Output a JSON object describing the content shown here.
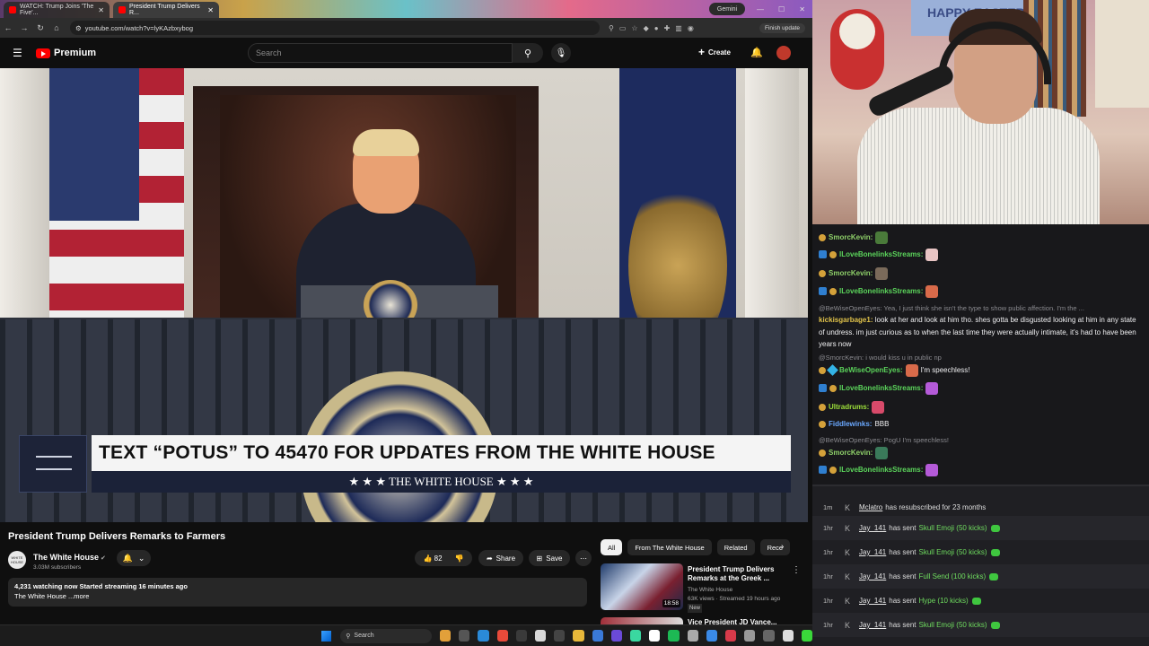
{
  "browser": {
    "tab1_title": "WATCH: Trump Joins 'The Five'...",
    "tab2_title": "President Trump Delivers R...",
    "gemini_label": "Gemini",
    "url": "youtube.com/watch?v=lyKAzbxybog",
    "finish_update": "Finish update"
  },
  "youtube": {
    "logo_text": "Premium",
    "search_placeholder": "Search",
    "create_label": "Create",
    "banner_main": "TEXT “POTUS” TO 45470 FOR UPDATES FROM THE WHITE HOUSE",
    "banner_sub": "★ ★ ★   THE WHITE HOUSE   ★ ★ ★",
    "video_title": "President Trump Delivers Remarks to Farmers",
    "channel_name": "The White House",
    "channel_avatar_text": "WHITE HOUSE",
    "subscribers": "3.03M subscribers",
    "likes": "82",
    "share_label": "Share",
    "save_label": "Save",
    "desc_line1": "4,231 watching now  Started streaming 16 minutes ago",
    "desc_line2": "The White House ...more",
    "chips": [
      "All",
      "From The White House",
      "Related",
      "Rece"
    ],
    "rec1_title": "President Trump Delivers Remarks at the Greek ...",
    "rec1_channel": "The White House",
    "rec1_meta": "63K views · Streamed 19 hours ago",
    "rec1_badge": "New",
    "rec1_duration": "18:58",
    "rec2_title": "Vice President JD Vance..."
  },
  "chat": {
    "messages": [
      {
        "user": "SmorcKevin:",
        "color": "#8fd16a",
        "text": ""
      },
      {
        "user": "ILoveBonelinksStreams:",
        "color": "#5bd45b",
        "text": ""
      },
      {
        "user": "SmorcKevin:",
        "color": "#8fd16a",
        "text": ""
      },
      {
        "user": "ILoveBonelinksStreams:",
        "color": "#5bd45b",
        "text": ""
      }
    ],
    "reply1": "@BeWiseOpenEyes: Yea, I just think she isn't the type to show public affection. I'm the ...",
    "long_user": "kickisgarbage1:",
    "long_text": "look at her and look at him tho. shes gotta be disgusted looking at him in any state of undress. im just curious as to when the last time they were actually intimate, it's had to have been years now",
    "reply2": "@SmorcKevin: i would kiss u in public np",
    "msg5_user": "BeWiseOpenEyes:",
    "msg5_text": "I'm speechless!",
    "msg6_user": "ILoveBonelinksStreams:",
    "msg7_user": "Ultradrums:",
    "msg8_user": "Fiddlewinks:",
    "msg8_text": "BBB",
    "reply3": "@BeWiseOpenEyes: PogU I'm speechless!",
    "msg9_user": "SmorcKevin:",
    "msg10_user": "ILoveBonelinksStreams:"
  },
  "events": [
    {
      "time": "1m",
      "user": "Mclatro",
      "text": "has resubscribed for 23 months",
      "gift": ""
    },
    {
      "time": "1hr",
      "user": "Jay_141",
      "text": "has sent",
      "gift": "Skull Emoji (50 kicks)"
    },
    {
      "time": "1hr",
      "user": "Jay_141",
      "text": "has sent",
      "gift": "Skull Emoji (50 kicks)"
    },
    {
      "time": "1hr",
      "user": "Jay_141",
      "text": "has sent",
      "gift": "Full Send (100 kicks)"
    },
    {
      "time": "1hr",
      "user": "Jay_141",
      "text": "has sent",
      "gift": "Hype (10 kicks)"
    },
    {
      "time": "1hr",
      "user": "Jay_141",
      "text": "has sent",
      "gift": "Skull Emoji (50 kicks)"
    }
  ],
  "webcam": {
    "bg_text": "HAPPY EASTER"
  },
  "taskbar": {
    "search_label": "Search"
  },
  "colors": {
    "yt_red": "#ff0000",
    "chat_bg": "#18181b",
    "kick_green": "#6fdc5f"
  }
}
